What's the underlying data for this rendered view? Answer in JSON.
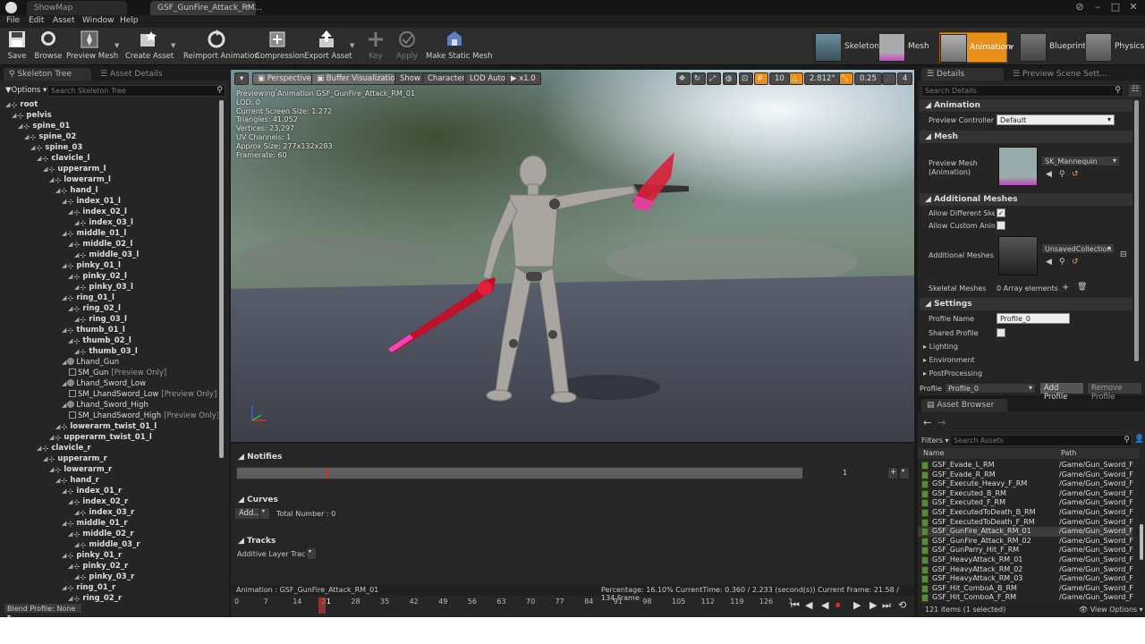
{
  "window": {
    "tabs": [
      {
        "label": "ShowMap"
      },
      {
        "label": "GSF_GunFire_Attack_RM..."
      }
    ]
  },
  "menu": [
    "File",
    "Edit",
    "Asset",
    "Window",
    "Help"
  ],
  "toolbar": {
    "buttons": [
      "Save",
      "Browse",
      "Preview Mesh",
      "Create Asset",
      "Reimport Animation",
      "Compression",
      "Export Asset",
      "Key",
      "Apply",
      "Make Static Mesh"
    ],
    "modes": [
      "Skeleton",
      "Mesh",
      "Animation",
      "Blueprint",
      "Physics"
    ],
    "active_mode": "Animation",
    "active_color": "#e8901a"
  },
  "left_panel": {
    "tabs": [
      "Skeleton Tree",
      "Asset Details"
    ],
    "options_label": "Options",
    "search_placeholder": "Search Skeleton Tree",
    "bones": [
      {
        "name": "root",
        "depth": 0,
        "bold": true
      },
      {
        "name": "pelvis",
        "depth": 1,
        "bold": true
      },
      {
        "name": "spine_01",
        "depth": 2,
        "bold": true
      },
      {
        "name": "spine_02",
        "depth": 3,
        "bold": true
      },
      {
        "name": "spine_03",
        "depth": 4,
        "bold": true
      },
      {
        "name": "clavicle_l",
        "depth": 5,
        "bold": true
      },
      {
        "name": "upperarm_l",
        "depth": 6,
        "bold": true
      },
      {
        "name": "lowerarm_l",
        "depth": 7,
        "bold": true
      },
      {
        "name": "hand_l",
        "depth": 8,
        "bold": true
      },
      {
        "name": "index_01_l",
        "depth": 9,
        "bold": true
      },
      {
        "name": "index_02_l",
        "depth": 10,
        "bold": true
      },
      {
        "name": "index_03_l",
        "depth": 11,
        "bold": true
      },
      {
        "name": "middle_01_l",
        "depth": 9,
        "bold": true
      },
      {
        "name": "middle_02_l",
        "depth": 10,
        "bold": true
      },
      {
        "name": "middle_03_l",
        "depth": 11,
        "bold": true
      },
      {
        "name": "pinky_01_l",
        "depth": 9,
        "bold": true
      },
      {
        "name": "pinky_02_l",
        "depth": 10,
        "bold": true
      },
      {
        "name": "pinky_03_l",
        "depth": 11,
        "bold": true
      },
      {
        "name": "ring_01_l",
        "depth": 9,
        "bold": true
      },
      {
        "name": "ring_02_l",
        "depth": 10,
        "bold": true
      },
      {
        "name": "ring_03_l",
        "depth": 11,
        "bold": true
      },
      {
        "name": "thumb_01_l",
        "depth": 9,
        "bold": true
      },
      {
        "name": "thumb_02_l",
        "depth": 10,
        "bold": true
      },
      {
        "name": "thumb_03_l",
        "depth": 11,
        "bold": true
      },
      {
        "name": "Lhand_Gun",
        "depth": 9,
        "bold": false,
        "socket": true
      },
      {
        "name": "SM_Gun",
        "depth": 10,
        "bold": false,
        "preview": "[Preview Only]"
      },
      {
        "name": "Lhand_Sword_Low",
        "depth": 9,
        "bold": false,
        "socket": true
      },
      {
        "name": "SM_LhandSword_Low",
        "depth": 10,
        "bold": false,
        "preview": "[Preview Only]"
      },
      {
        "name": "Lhand_Sword_High",
        "depth": 9,
        "bold": false,
        "socket": true
      },
      {
        "name": "SM_LhandSword_High",
        "depth": 10,
        "bold": false,
        "preview": "[Preview Only]"
      },
      {
        "name": "lowerarm_twist_01_l",
        "depth": 8,
        "bold": true
      },
      {
        "name": "upperarm_twist_01_l",
        "depth": 7,
        "bold": true
      },
      {
        "name": "clavicle_r",
        "depth": 5,
        "bold": true
      },
      {
        "name": "upperarm_r",
        "depth": 6,
        "bold": true
      },
      {
        "name": "lowerarm_r",
        "depth": 7,
        "bold": true
      },
      {
        "name": "hand_r",
        "depth": 8,
        "bold": true
      },
      {
        "name": "index_01_r",
        "depth": 9,
        "bold": true
      },
      {
        "name": "index_02_r",
        "depth": 10,
        "bold": true
      },
      {
        "name": "index_03_r",
        "depth": 11,
        "bold": true
      },
      {
        "name": "middle_01_r",
        "depth": 9,
        "bold": true
      },
      {
        "name": "middle_02_r",
        "depth": 10,
        "bold": true
      },
      {
        "name": "middle_03_r",
        "depth": 11,
        "bold": true
      },
      {
        "name": "pinky_01_r",
        "depth": 9,
        "bold": true
      },
      {
        "name": "pinky_02_r",
        "depth": 10,
        "bold": true
      },
      {
        "name": "pinky_03_r",
        "depth": 11,
        "bold": true
      },
      {
        "name": "ring_01_r",
        "depth": 9,
        "bold": true
      },
      {
        "name": "ring_02_r",
        "depth": 10,
        "bold": true
      }
    ],
    "blend_profile": "Blend Profile: None"
  },
  "viewport": {
    "top_buttons": [
      "Perspective",
      "Buffer Visualization",
      "Show",
      "Character",
      "LOD Auto",
      "x1.0"
    ],
    "grid_snap": "10",
    "rot_snap": "2.812°",
    "scale_snap": "0.25",
    "cam_speed": "4",
    "stats": [
      "Previewing Animation GSF_GunFire_Attack_RM_01",
      "LOD: 0",
      "Current Screen Size: 1.272",
      "Triangles: 41,052",
      "Vertices: 23,297",
      "UV Channels: 1",
      "Approx Size: 277x132x283",
      "Framerate: 60"
    ]
  },
  "timeline": {
    "notifies_label": "Notifies",
    "notify_track_value": "1",
    "curves_label": "Curves",
    "add_label": "Add...",
    "total_number": "Total Number : 0",
    "tracks_label": "Tracks",
    "additive_label": "Additive Layer Tracks",
    "animation_label": "Animation : GSF_GunFire_Attack_RM_01",
    "status": "Percentage:  16.10% CurrentTime:  0.360 / 2.233 (second(s)) Current Frame:  21.58 / 134 Frame",
    "ticks": [
      "0",
      "7",
      "14",
      "21",
      "28",
      "35",
      "42",
      "49",
      "56",
      "63",
      "70",
      "77",
      "84",
      "91",
      "98",
      "105",
      "112",
      "119",
      "126",
      "1"
    ],
    "current_tick": "21"
  },
  "details": {
    "tabs": [
      "Details",
      "Preview Scene Sett..."
    ],
    "search_placeholder": "Search Details",
    "animation_hdr": "Animation",
    "preview_controller_label": "Preview Controller",
    "preview_controller_value": "Default",
    "mesh_hdr": "Mesh",
    "preview_mesh_label": "Preview Mesh (Animation)",
    "preview_mesh_value": "SK_Mannequin",
    "additional_hdr": "Additional Meshes",
    "allow_diff_label": "Allow Different Skele",
    "allow_custom_label": "Allow Custom AnimBl",
    "additional_meshes_label": "Additional Meshes",
    "additional_meshes_value": "UnsavedCollection",
    "skeletal_meshes_label": "Skeletal Meshes",
    "skeletal_meshes_value": "0 Array elements",
    "settings_hdr": "Settings",
    "profile_name_label": "Profile Name",
    "profile_name_value": "Profile_0",
    "shared_profile_label": "Shared Profile",
    "lighting": "Lighting",
    "environment": "Environment",
    "postprocessing": "PostProcessing",
    "profile_label": "Profile",
    "profile_value": "Profile_0",
    "add_profile": "Add Profile",
    "remove_profile": "Remove Profile"
  },
  "asset_browser": {
    "tab": "Asset Browser",
    "filters": "Filters",
    "search_placeholder": "Search Assets",
    "col_name": "Name",
    "col_path": "Path",
    "rows": [
      {
        "name": "GSF_Evade_L_RM",
        "path": "/Game/Gun_Sword_F"
      },
      {
        "name": "GSF_Evade_R_RM",
        "path": "/Game/Gun_Sword_F"
      },
      {
        "name": "GSF_Execute_Heavy_F_RM",
        "path": "/Game/Gun_Sword_F"
      },
      {
        "name": "GSF_Executed_B_RM",
        "path": "/Game/Gun_Sword_F"
      },
      {
        "name": "GSF_Executed_F_RM",
        "path": "/Game/Gun_Sword_F"
      },
      {
        "name": "GSF_ExecutedToDeath_B_RM",
        "path": "/Game/Gun_Sword_F"
      },
      {
        "name": "GSF_ExecutedToDeath_F_RM",
        "path": "/Game/Gun_Sword_F"
      },
      {
        "name": "GSF_GunFire_Attack_RM_01",
        "path": "/Game/Gun_Sword_F",
        "selected": true
      },
      {
        "name": "GSF_GunFire_Attack_RM_02",
        "path": "/Game/Gun_Sword_F"
      },
      {
        "name": "GSF_GunParry_Hit_F_RM",
        "path": "/Game/Gun_Sword_F"
      },
      {
        "name": "GSF_HeavyAttack_RM_01",
        "path": "/Game/Gun_Sword_F"
      },
      {
        "name": "GSF_HeavyAttack_RM_02",
        "path": "/Game/Gun_Sword_F"
      },
      {
        "name": "GSF_HeavyAttack_RM_03",
        "path": "/Game/Gun_Sword_F"
      },
      {
        "name": "GSF_Hit_ComboA_B_RM",
        "path": "/Game/Gun_Sword_F"
      },
      {
        "name": "GSF_Hit_ComboA_F_RM",
        "path": "/Game/Gun_Sword_F"
      }
    ],
    "count": "121 items (1 selected)",
    "view_options": "View Options"
  }
}
